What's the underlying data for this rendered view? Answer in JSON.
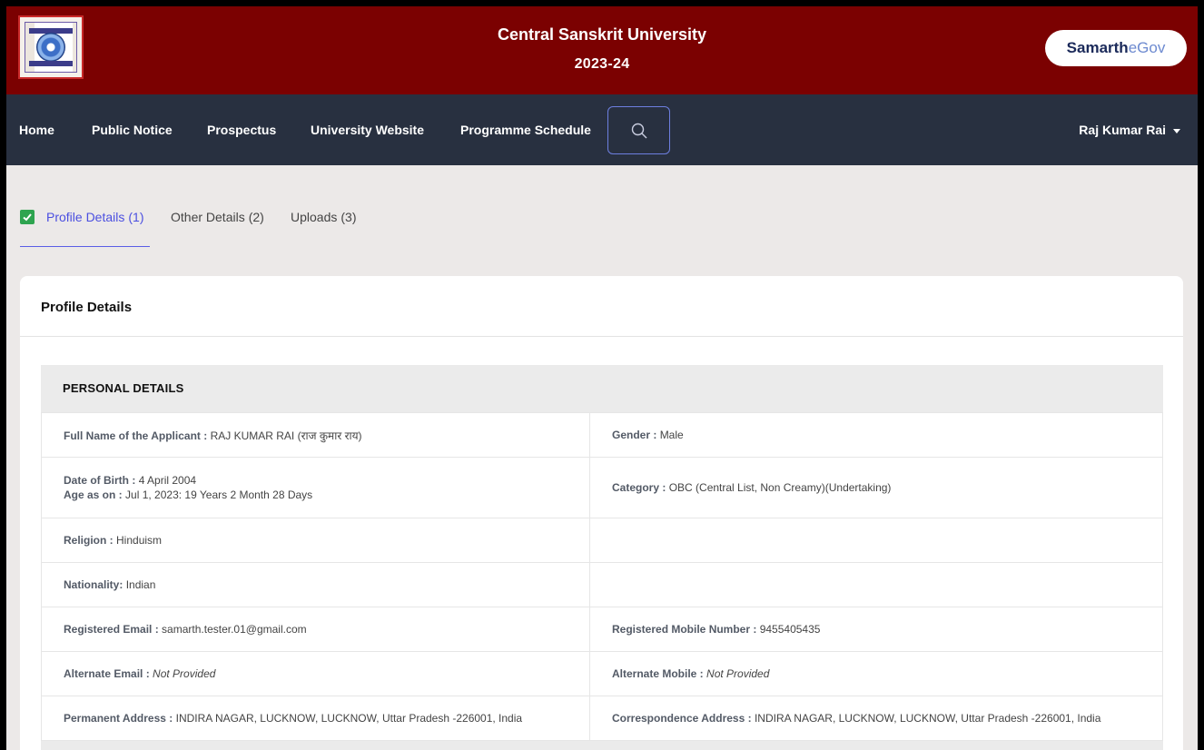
{
  "header": {
    "title": "Central Sanskrit University",
    "year": "2023-24",
    "brand_part1": "Samarth",
    "brand_part2": "eGov"
  },
  "nav": {
    "home": "Home",
    "public_notice": "Public Notice",
    "prospectus": "Prospectus",
    "university_website": "University Website",
    "programme_schedule": "Programme Schedule",
    "user": "Raj Kumar Rai"
  },
  "tabs": [
    {
      "label": "Profile Details",
      "num": "(1)"
    },
    {
      "label": "Other Details",
      "num": "(2)"
    },
    {
      "label": "Uploads",
      "num": "(3)"
    }
  ],
  "card": {
    "title": "Profile Details",
    "section_title": "PERSONAL DETAILS"
  },
  "details": {
    "full_name": {
      "label": "Full Name of the Applicant :",
      "value": "RAJ KUMAR RAI (राज कुमार राय)"
    },
    "gender": {
      "label": "Gender :",
      "value": "Male"
    },
    "dob": {
      "label": "Date of Birth :",
      "value": "4 April 2004"
    },
    "age": {
      "label": "Age as on :",
      "value": "Jul 1, 2023: 19 Years 2 Month 28 Days"
    },
    "category": {
      "label": "Category :",
      "value": "OBC (Central List, Non Creamy)(Undertaking)"
    },
    "religion": {
      "label": "Religion :",
      "value": "Hinduism"
    },
    "nationality": {
      "label": "Nationality:",
      "value": "Indian"
    },
    "email": {
      "label": "Registered Email :",
      "value": "samarth.tester.01@gmail.com"
    },
    "mobile": {
      "label": "Registered Mobile Number :",
      "value": "9455405435"
    },
    "alt_email": {
      "label": "Alternate Email :",
      "value": "Not Provided"
    },
    "alt_mobile": {
      "label": "Alternate Mobile :",
      "value": "Not Provided"
    },
    "perm_address": {
      "label": "Permanent Address :",
      "value": "INDIRA NAGAR, LUCKNOW, LUCKNOW, Uttar Pradesh -226001, India"
    },
    "corr_address": {
      "label": "Correspondence Address :",
      "value": "INDIRA NAGAR, LUCKNOW, LUCKNOW, Uttar Pradesh -226001, India"
    }
  },
  "colors": {
    "header_bg": "#7b0101",
    "nav_bg": "#283040",
    "accent": "#4b4fe0",
    "check": "#2ea44f"
  },
  "icons": {
    "search": "search-icon",
    "check": "check-icon",
    "caret": "caret-down-icon",
    "logo": "university-logo"
  }
}
